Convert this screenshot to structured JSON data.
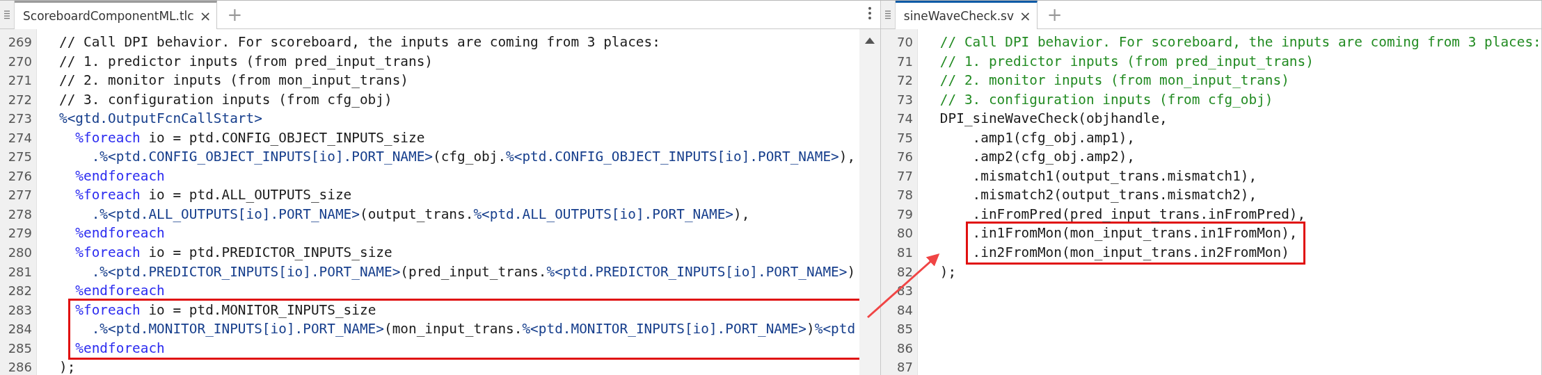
{
  "panes": [
    {
      "tab": {
        "title": "ScoreboardComponentML.tlc",
        "close": "×"
      },
      "new_tab": "+",
      "active": false,
      "menu": true,
      "scrollbar": true,
      "lines": [
        {
          "number": "269",
          "highlighted": false,
          "segments": [
            {
              "text": "// Call DPI behavior. For scoreboard, the inputs are coming from 3 places:",
              "kind": "plain"
            }
          ]
        },
        {
          "number": "270",
          "highlighted": false,
          "segments": [
            {
              "text": "// 1. predictor inputs (from pred_input_trans)",
              "kind": "plain"
            }
          ]
        },
        {
          "number": "271",
          "highlighted": false,
          "segments": [
            {
              "text": "// 2. monitor inputs (from mon_input_trans)",
              "kind": "plain"
            }
          ]
        },
        {
          "number": "272",
          "highlighted": false,
          "segments": [
            {
              "text": "// 3. configuration inputs (from cfg_obj)",
              "kind": "plain"
            }
          ]
        },
        {
          "number": "273",
          "highlighted": false,
          "segments": [
            {
              "text": "%<gtd.OutputFcnCallStart>",
              "kind": "expansion"
            }
          ]
        },
        {
          "number": "274",
          "highlighted": false,
          "segments": [
            {
              "text": "  %foreach",
              "kind": "keyword"
            },
            {
              "text": " io = ptd.CONFIG_OBJECT_INPUTS_size",
              "kind": "plain"
            }
          ]
        },
        {
          "number": "275",
          "highlighted": false,
          "segments": [
            {
              "text": "    .%<ptd.CONFIG_OBJECT_INPUTS[io].PORT_NAME>",
              "kind": "expansion"
            },
            {
              "text": "(cfg_obj.",
              "kind": "plain"
            },
            {
              "text": "%<ptd.CONFIG_OBJECT_INPUTS[io].PORT_NAME>",
              "kind": "expansion"
            },
            {
              "text": "),",
              "kind": "plain"
            }
          ]
        },
        {
          "number": "276",
          "highlighted": false,
          "segments": [
            {
              "text": "  %endforeach",
              "kind": "keyword"
            }
          ]
        },
        {
          "number": "277",
          "highlighted": false,
          "segments": [
            {
              "text": "  %foreach",
              "kind": "keyword"
            },
            {
              "text": " io = ptd.ALL_OUTPUTS_size",
              "kind": "plain"
            }
          ]
        },
        {
          "number": "278",
          "highlighted": false,
          "segments": [
            {
              "text": "    .%<ptd.ALL_OUTPUTS[io].PORT_NAME>",
              "kind": "expansion"
            },
            {
              "text": "(output_trans.",
              "kind": "plain"
            },
            {
              "text": "%<ptd.ALL_OUTPUTS[io].PORT_NAME>",
              "kind": "expansion"
            },
            {
              "text": "),",
              "kind": "plain"
            }
          ]
        },
        {
          "number": "279",
          "highlighted": false,
          "segments": [
            {
              "text": "  %endforeach",
              "kind": "keyword"
            }
          ]
        },
        {
          "number": "280",
          "highlighted": false,
          "segments": [
            {
              "text": "  %foreach",
              "kind": "keyword"
            },
            {
              "text": " io = ptd.PREDICTOR_INPUTS_size",
              "kind": "plain"
            }
          ]
        },
        {
          "number": "281",
          "highlighted": false,
          "segments": [
            {
              "text": "    .%<ptd.PREDICTOR_INPUTS[io].PORT_NAME>",
              "kind": "expansion"
            },
            {
              "text": "(pred_input_trans.",
              "kind": "plain"
            },
            {
              "text": "%<ptd.PREDICTOR_INPUTS[io].PORT_NAME>",
              "kind": "expansion"
            },
            {
              "text": ")",
              "kind": "plain"
            }
          ]
        },
        {
          "number": "282",
          "highlighted": false,
          "segments": [
            {
              "text": "  %endforeach",
              "kind": "keyword"
            }
          ]
        },
        {
          "number": "283",
          "highlighted": true,
          "segments": [
            {
              "text": "  %foreach",
              "kind": "keyword"
            },
            {
              "text": " io = ptd.MONITOR_INPUTS_size",
              "kind": "plain"
            }
          ]
        },
        {
          "number": "284",
          "highlighted": true,
          "segments": [
            {
              "text": "    .%<ptd.MONITOR_INPUTS[io].PORT_NAME>",
              "kind": "expansion"
            },
            {
              "text": "(mon_input_trans.",
              "kind": "plain"
            },
            {
              "text": "%<ptd.MONITOR_INPUTS[io].PORT_NAME>",
              "kind": "expansion"
            },
            {
              "text": ")",
              "kind": "plain"
            },
            {
              "text": "%<ptd",
              "kind": "expansion"
            }
          ]
        },
        {
          "number": "285",
          "highlighted": true,
          "segments": [
            {
              "text": "  %endforeach",
              "kind": "keyword"
            }
          ]
        },
        {
          "number": "286",
          "highlighted": false,
          "segments": [
            {
              "text": ");",
              "kind": "plain"
            }
          ]
        }
      ]
    },
    {
      "tab": {
        "title": "sineWaveCheck.sv",
        "close": "×"
      },
      "new_tab": "+",
      "active": true,
      "lines": [
        {
          "number": "70",
          "highlighted": false,
          "segments": [
            {
              "text": "// Call DPI behavior. For scoreboard, the inputs are coming from 3 places:",
              "kind": "comment"
            }
          ]
        },
        {
          "number": "71",
          "highlighted": false,
          "segments": [
            {
              "text": "// 1. predictor inputs (from pred_input_trans)",
              "kind": "comment"
            }
          ]
        },
        {
          "number": "72",
          "highlighted": false,
          "segments": [
            {
              "text": "// 2. monitor inputs (from mon_input_trans)",
              "kind": "comment"
            }
          ]
        },
        {
          "number": "73",
          "highlighted": false,
          "segments": [
            {
              "text": "// 3. configuration inputs (from cfg_obj)",
              "kind": "comment"
            }
          ]
        },
        {
          "number": "74",
          "highlighted": false,
          "segments": [
            {
              "text": "DPI_sineWaveCheck(objhandle,",
              "kind": "plain"
            }
          ]
        },
        {
          "number": "75",
          "highlighted": false,
          "segments": [
            {
              "text": "    .amp1(cfg_obj.amp1),",
              "kind": "plain"
            }
          ]
        },
        {
          "number": "76",
          "highlighted": false,
          "segments": [
            {
              "text": "    .amp2(cfg_obj.amp2),",
              "kind": "plain"
            }
          ]
        },
        {
          "number": "77",
          "highlighted": false,
          "segments": [
            {
              "text": "    .mismatch1(output_trans.mismatch1),",
              "kind": "plain"
            }
          ]
        },
        {
          "number": "78",
          "highlighted": false,
          "segments": [
            {
              "text": "    .mismatch2(output_trans.mismatch2),",
              "kind": "plain"
            }
          ]
        },
        {
          "number": "79",
          "highlighted": false,
          "segments": [
            {
              "text": "    .inFromPred(pred_input_trans.inFromPred),",
              "kind": "plain"
            }
          ]
        },
        {
          "number": "80",
          "highlighted": true,
          "segments": [
            {
              "text": "    .in1FromMon(mon_input_trans.in1FromMon),",
              "kind": "plain"
            }
          ]
        },
        {
          "number": "81",
          "highlighted": true,
          "segments": [
            {
              "text": "    .in2FromMon(mon_input_trans.in2FromMon)",
              "kind": "plain"
            }
          ]
        },
        {
          "number": "82",
          "highlighted": false,
          "segments": [
            {
              "text": ");",
              "kind": "plain"
            }
          ]
        },
        {
          "number": "83"
        },
        {
          "number": "84"
        },
        {
          "number": "85"
        },
        {
          "number": "86"
        },
        {
          "number": "87"
        }
      ]
    }
  ]
}
